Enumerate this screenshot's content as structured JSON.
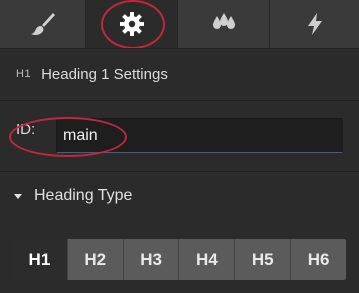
{
  "tabs": [
    {
      "icon": "brush-icon",
      "active": false
    },
    {
      "icon": "gear-icon",
      "active": true
    },
    {
      "icon": "droplets-icon",
      "active": false
    },
    {
      "icon": "lightning-icon",
      "active": false
    }
  ],
  "section": {
    "badge": "H1",
    "title": "Heading 1 Settings"
  },
  "id_field": {
    "label": "ID:",
    "value": "main"
  },
  "heading_type": {
    "label": "Heading Type",
    "options": [
      "H1",
      "H2",
      "H3",
      "H4",
      "H5",
      "H6"
    ],
    "selected": "H1"
  },
  "colors": {
    "annotation": "#c0283a",
    "focus_underline": "#3f5f86"
  }
}
